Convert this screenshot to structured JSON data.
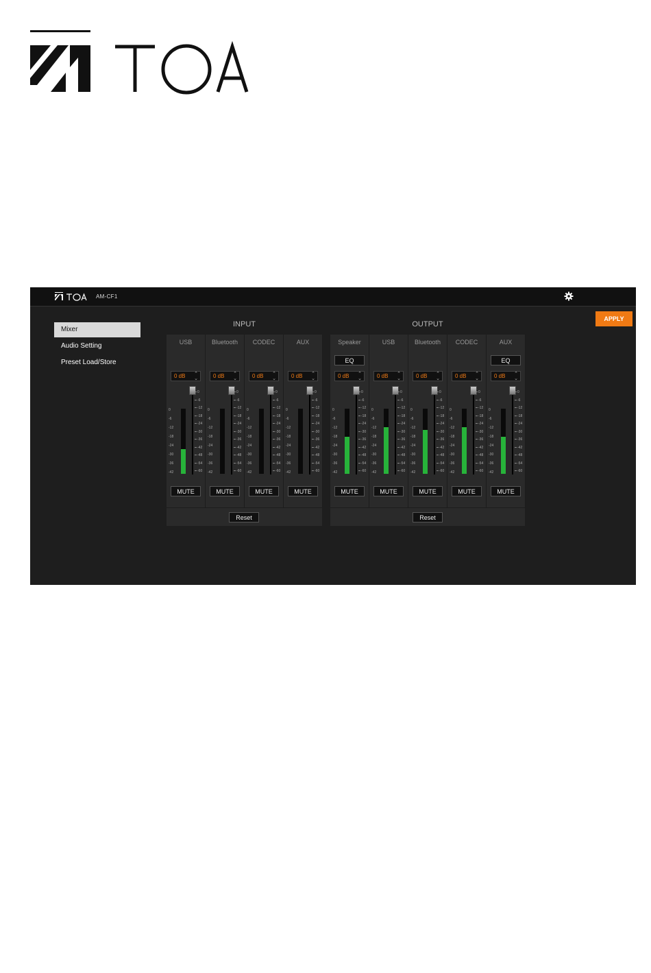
{
  "brand": {
    "logo_text": "TOA"
  },
  "app": {
    "logo_text": "TOA",
    "model": "AM-CF1",
    "settings_icon": "gear-icon",
    "apply_label": "APPLY",
    "accent_color": "#f07a14",
    "meter_color": "#27b33a"
  },
  "menu": {
    "items": [
      {
        "label": "Mixer",
        "active": true
      },
      {
        "label": "Audio Setting",
        "active": false
      },
      {
        "label": "Preset Load/Store",
        "active": false
      }
    ]
  },
  "input": {
    "title": "INPUT",
    "reset_label": "Reset",
    "channels": [
      {
        "name": "USB",
        "gain": "0 dB",
        "mute": "MUTE",
        "level": 0.38
      },
      {
        "name": "Bluetooth",
        "gain": "0 dB",
        "mute": "MUTE",
        "level": 0
      },
      {
        "name": "CODEC",
        "gain": "0 dB",
        "mute": "MUTE",
        "level": 0
      },
      {
        "name": "AUX",
        "gain": "0 dB",
        "mute": "MUTE",
        "level": 0
      }
    ]
  },
  "output": {
    "title": "OUTPUT",
    "reset_label": "Reset",
    "channels": [
      {
        "name": "Speaker",
        "eq": "EQ",
        "gain": "0 dB",
        "mute": "MUTE",
        "level": 0.57
      },
      {
        "name": "USB",
        "eq": "",
        "gain": "0 dB",
        "mute": "MUTE",
        "level": 0.72
      },
      {
        "name": "Bluetooth",
        "eq": "",
        "gain": "0 dB",
        "mute": "MUTE",
        "level": 0.67
      },
      {
        "name": "CODEC",
        "eq": "",
        "gain": "0 dB",
        "mute": "MUTE",
        "level": 0.72
      },
      {
        "name": "AUX",
        "eq": "EQ",
        "gain": "0 dB",
        "mute": "MUTE",
        "level": 0.57
      }
    ]
  },
  "scales": {
    "meter": [
      "0",
      "-6",
      "-12",
      "-18",
      "-24",
      "-30",
      "-36",
      "-42"
    ],
    "fader": [
      "0",
      "-6",
      "-12",
      "-18",
      "-24",
      "-30",
      "-36",
      "-42",
      "-48",
      "-54",
      "-60"
    ]
  }
}
